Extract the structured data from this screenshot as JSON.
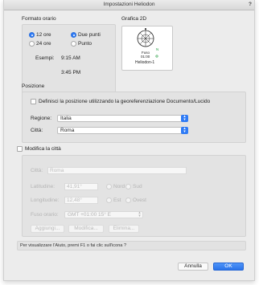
{
  "window": {
    "title": "Impostazioni Heliodon",
    "help": "?"
  },
  "time_format": {
    "label": "Formato orario",
    "radio_12": "12 ore",
    "radio_24": "24 ore",
    "radio_colon": "Due punti",
    "radio_dot": "Punto",
    "examples_label": "Esempi:",
    "example_1": "9:15 AM",
    "example_2": "3:45 PM"
  },
  "graphic": {
    "label": "Grafica 2D",
    "top_text": "Fuso",
    "mid_text": "01:00",
    "side_text": "N",
    "name": "Heliodon-1"
  },
  "position": {
    "label": "Posizione",
    "georef_checkbox": "Definisci la posizione utilizzando la georeferenziazione Documento/Lucido",
    "region_label": "Regione:",
    "region_value": "Italia",
    "city_label": "Città:",
    "city_value": "Roma"
  },
  "edit_city": {
    "checkbox": "Modifica la città",
    "city_label": "Città:",
    "city_value": "Roma",
    "lat_label": "Latitudine:",
    "lat_value": "41,91°",
    "north": "Nord",
    "south": "Sud",
    "lon_label": "Longitudine:",
    "lon_value": "12,48°",
    "east": "Est",
    "west": "Ovest",
    "tz_label": "Fuso orario:",
    "tz_value": "GMT +01:00 15° E",
    "add_btn": "Aggiungi...",
    "modify_btn": "Modifica...",
    "delete_btn": "Elimina..."
  },
  "hint": "Per visualizzare l'Aiuto, premi F1 o fai clic sull'icona ?",
  "footer": {
    "cancel": "Annulla",
    "ok": "OK"
  },
  "colors": {
    "accent": "#2f7bf5"
  }
}
